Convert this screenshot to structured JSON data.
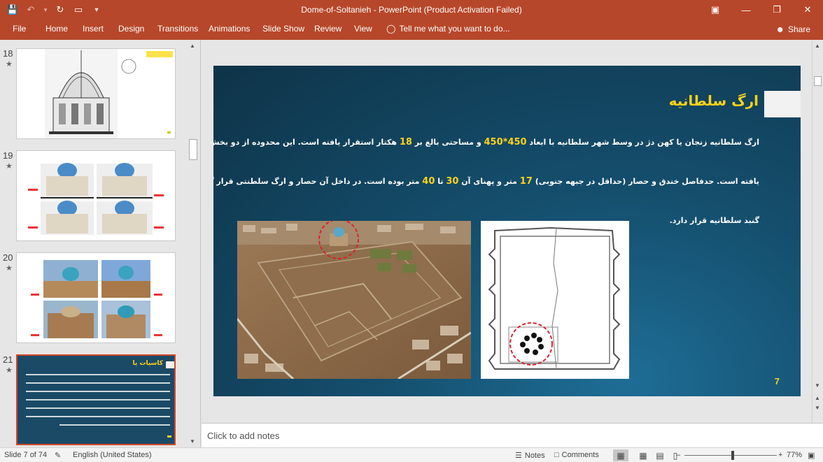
{
  "window": {
    "title": "Dome-of-Soltanieh - PowerPoint (Product Activation Failed)"
  },
  "ribbon": {
    "tabs": [
      "File",
      "Home",
      "Insert",
      "Design",
      "Transitions",
      "Animations",
      "Slide Show",
      "Review",
      "View"
    ],
    "tell_me": "Tell me what you want to do...",
    "share": "Share"
  },
  "thumbnails": [
    {
      "number": "18",
      "star": "★"
    },
    {
      "number": "19",
      "star": "★"
    },
    {
      "number": "20",
      "star": "★"
    },
    {
      "number": "21",
      "star": "★",
      "title": "کاسیات یا"
    }
  ],
  "slide": {
    "title": "ارگ سلطانیه",
    "line1": {
      "a": "ارگ سلطانیه زنجان یا کهن دژ در وسط شهر سلطانیه با ابعاد ",
      "n1": "450*450",
      "b": " و مساحتی بالغ بر ",
      "n2": "18",
      "c": " هکتار استقرار یافته است. این محدوده از دو بخش خندق و حصار تشکیل"
    },
    "line2": {
      "a": "یافته است. حدفاصل خندق و حصار (حداقل در جبهه جنوبی) ",
      "n1": "17",
      "b": " متر و پهنای آن ",
      "n2": "30",
      "c": " تا ",
      "n3": "40",
      "d": " متر بوده است. در داخل آن حصار و ارگ سلطنتی قرار گرفته است و در آن بنای"
    },
    "line3": "گنبد سلطانیه قرار دارد.",
    "number": "7"
  },
  "notes": {
    "placeholder": "Click to add notes"
  },
  "status": {
    "slide_info": "Slide 7 of 74",
    "language": "English (United States)",
    "notes_label": "Notes",
    "comments_label": "Comments",
    "zoom": "77%"
  },
  "colors": {
    "accent": "#b7472a",
    "slide_highlight": "#ffd11a"
  }
}
